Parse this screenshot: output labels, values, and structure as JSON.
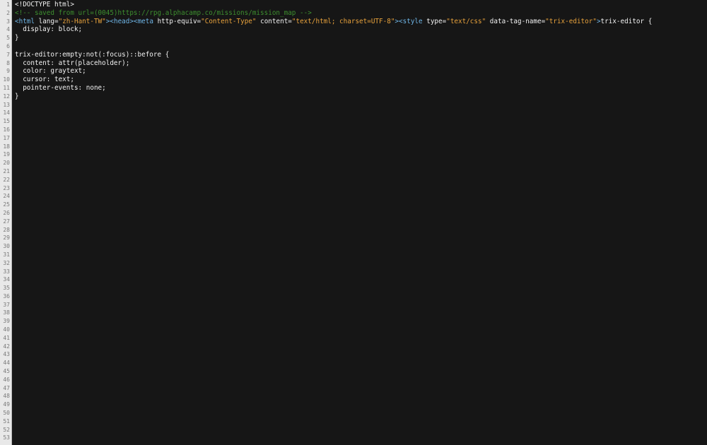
{
  "gutter": {
    "line_numbers": [
      "1",
      "2",
      "3",
      "4",
      "5",
      "6",
      "7",
      "8",
      "9",
      "10",
      "11",
      "12",
      "13",
      "14",
      "15",
      "16",
      "17",
      "18",
      "19",
      "20",
      "21",
      "22",
      "23",
      "24",
      "25",
      "26",
      "27",
      "28",
      "29",
      "30",
      "31",
      "32",
      "33",
      "34",
      "35",
      "36",
      "37",
      "38",
      "39",
      "40",
      "41",
      "42",
      "43",
      "44",
      "45",
      "46",
      "47",
      "48",
      "49",
      "50",
      "51",
      "52",
      "53"
    ]
  },
  "colors": {
    "background": "#161616",
    "gutter_bg": "#e8e8e8",
    "default_text": "#f2f2f2",
    "comment": "#3d8f2f",
    "tag": "#6fb5e6",
    "string": "#e8a23c"
  },
  "code": {
    "line1": {
      "doctype": "<!DOCTYPE html>"
    },
    "line2": {
      "comment": "<!-- saved from url=(0045)https://rpg.alphacamp.co/missions/mission_map -->"
    },
    "line3": {
      "html_open": "<html",
      "lang_attr": " lang=",
      "lang_val": "\"zh-Hant-TW\"",
      "html_close": ">",
      "head_tag": "<head>",
      "meta_open": "<meta",
      "http_equiv_attr": " http-equiv=",
      "http_equiv_val": "\"Content-Type\"",
      "content_attr": " content=",
      "content_val": "\"text/html; charset=UTF-8\"",
      "meta_close": ">",
      "style_open": "<style",
      "type_attr": " type=",
      "type_val": "\"text/css\"",
      "data_tag_attr": " data-tag-name=",
      "data_tag_val": "\"trix-editor\"",
      "style_close": ">",
      "trailing_text": "trix-editor {"
    },
    "line4": {
      "text": "  display: block;"
    },
    "line5": {
      "text": "}"
    },
    "line6": {
      "text": ""
    },
    "line7": {
      "text": "trix-editor:empty:not(:focus)::before {"
    },
    "line8": {
      "text": "  content: attr(placeholder);"
    },
    "line9": {
      "text": "  color: graytext;"
    },
    "line10": {
      "text": "  cursor: text;"
    },
    "line11": {
      "text": "  pointer-events: none;"
    },
    "line12": {
      "text": "}"
    }
  }
}
